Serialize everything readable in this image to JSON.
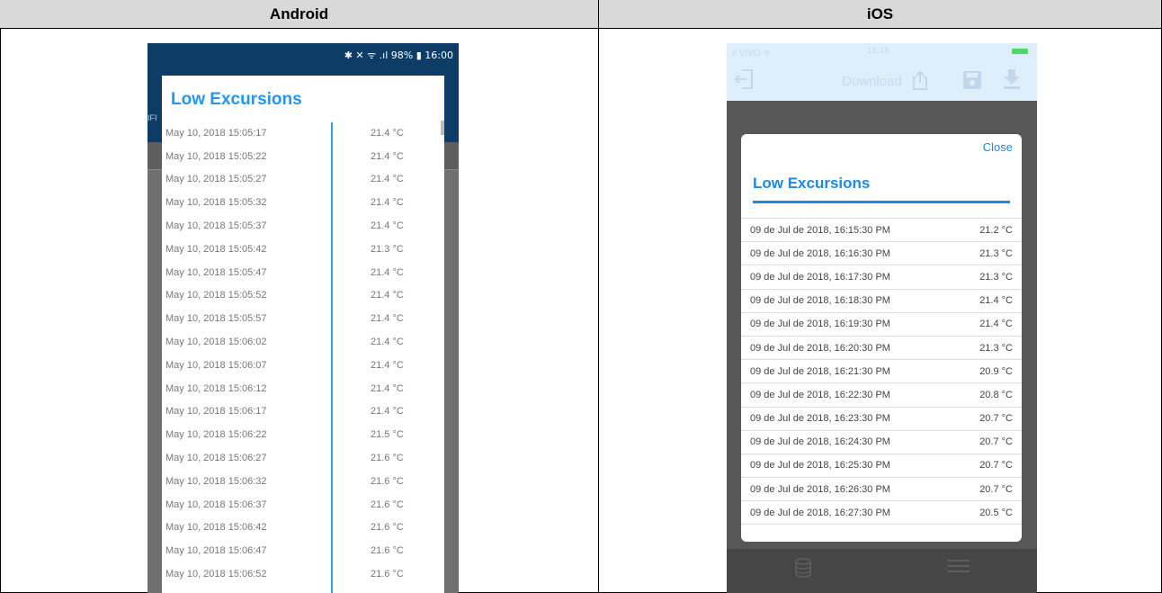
{
  "headers": {
    "android": "Android",
    "ios": "iOS"
  },
  "android": {
    "status_bar": "✱ ✕ ᯤ .ıl 98% ▮ 16:00",
    "tab_fragment": "IFI",
    "dialog_title": "Low Excursions",
    "rows": [
      {
        "date": "May 10, 2018 15:05:17",
        "value": "21.4 °C"
      },
      {
        "date": "May 10, 2018 15:05:22",
        "value": "21.4 °C"
      },
      {
        "date": "May 10, 2018 15:05:27",
        "value": "21.4 °C"
      },
      {
        "date": "May 10, 2018 15:05:32",
        "value": "21.4 °C"
      },
      {
        "date": "May 10, 2018 15:05:37",
        "value": "21.4 °C"
      },
      {
        "date": "May 10, 2018 15:05:42",
        "value": "21.3 °C"
      },
      {
        "date": "May 10, 2018 15:05:47",
        "value": "21.4 °C"
      },
      {
        "date": "May 10, 2018 15:05:52",
        "value": "21.4 °C"
      },
      {
        "date": "May 10, 2018 15:05:57",
        "value": "21.4 °C"
      },
      {
        "date": "May 10, 2018 15:06:02",
        "value": "21.4 °C"
      },
      {
        "date": "May 10, 2018 15:06:07",
        "value": "21.4 °C"
      },
      {
        "date": "May 10, 2018 15:06:12",
        "value": "21.4 °C"
      },
      {
        "date": "May 10, 2018 15:06:17",
        "value": "21.4 °C"
      },
      {
        "date": "May 10, 2018 15:06:22",
        "value": "21.5 °C"
      },
      {
        "date": "May 10, 2018 15:06:27",
        "value": "21.6 °C"
      },
      {
        "date": "May 10, 2018 15:06:32",
        "value": "21.6 °C"
      },
      {
        "date": "May 10, 2018 15:06:37",
        "value": "21.6 °C"
      },
      {
        "date": "May 10, 2018 15:06:42",
        "value": "21.6 °C"
      },
      {
        "date": "May 10, 2018 15:06:47",
        "value": "21.6 °C"
      },
      {
        "date": "May 10, 2018 15:06:52",
        "value": "21.6 °C"
      }
    ]
  },
  "ios": {
    "carrier": "ıl VIVO ᯤ",
    "time": "16:16",
    "nav_title": "Download",
    "close_label": "Close",
    "dialog_title": "Low Excursions",
    "icons": {
      "back": "exit-icon",
      "share": "share-icon",
      "save": "save-icon",
      "download": "download-icon",
      "database": "database-icon",
      "menu": "menu-icon"
    },
    "rows": [
      {
        "date": "09 de Jul de 2018, 16:15:30 PM",
        "value": "21.2 °C"
      },
      {
        "date": "09 de Jul de 2018, 16:16:30 PM",
        "value": "21.3 °C"
      },
      {
        "date": "09 de Jul de 2018, 16:17:30 PM",
        "value": "21.3 °C"
      },
      {
        "date": "09 de Jul de 2018, 16:18:30 PM",
        "value": "21.4 °C"
      },
      {
        "date": "09 de Jul de 2018, 16:19:30 PM",
        "value": "21.4 °C"
      },
      {
        "date": "09 de Jul de 2018, 16:20:30 PM",
        "value": "21.3 °C"
      },
      {
        "date": "09 de Jul de 2018, 16:21:30 PM",
        "value": "20.9 °C"
      },
      {
        "date": "09 de Jul de 2018, 16:22:30 PM",
        "value": "20.8 °C"
      },
      {
        "date": "09 de Jul de 2018, 16:23:30 PM",
        "value": "20.7 °C"
      },
      {
        "date": "09 de Jul de 2018, 16:24:30 PM",
        "value": "20.7 °C"
      },
      {
        "date": "09 de Jul de 2018, 16:25:30 PM",
        "value": "20.7 °C"
      },
      {
        "date": "09 de Jul de 2018, 16:26:30 PM",
        "value": "20.7 °C"
      },
      {
        "date": "09 de Jul de 2018, 16:27:30 PM",
        "value": "20.5 °C"
      }
    ]
  }
}
